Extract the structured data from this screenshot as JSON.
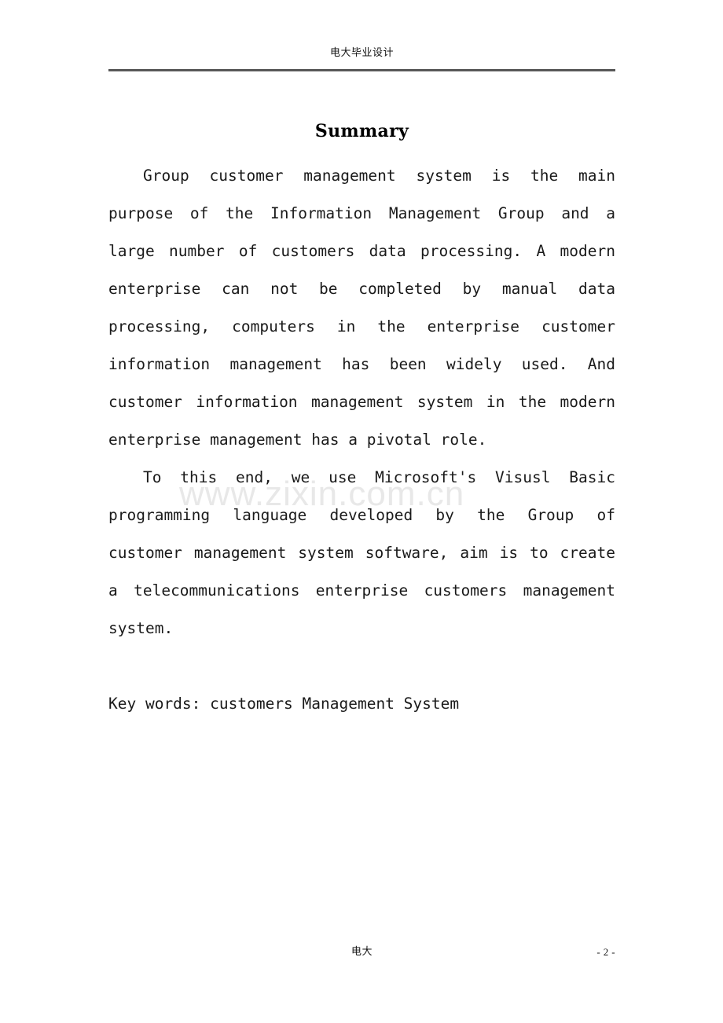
{
  "document": {
    "header": {
      "text": "电大毕业设计"
    },
    "title": "Summary",
    "paragraphs": [
      {
        "id": "abstract-paragraph-1",
        "indent": true,
        "text": "Group customer management system is the main purpose of the Information Management Group and a large number of customers data processing. A modern enterprise can not be completed by manual data processing, computers in the enterprise customer information management has been widely used. And customer information management system in the modern enterprise management has a pivotal role."
      },
      {
        "id": "abstract-paragraph-2",
        "indent": true,
        "text": "To this end, we use Microsoft's Visusl Basic programming language developed by the Group of customer management system software, aim is to create a telecommunications enterprise customers management system."
      }
    ],
    "keywords_line": "Key words: customers Management System",
    "watermark": "www.zixin.com.cn",
    "footer": {
      "center_text": "电大",
      "page_number": "- 2 -"
    }
  }
}
